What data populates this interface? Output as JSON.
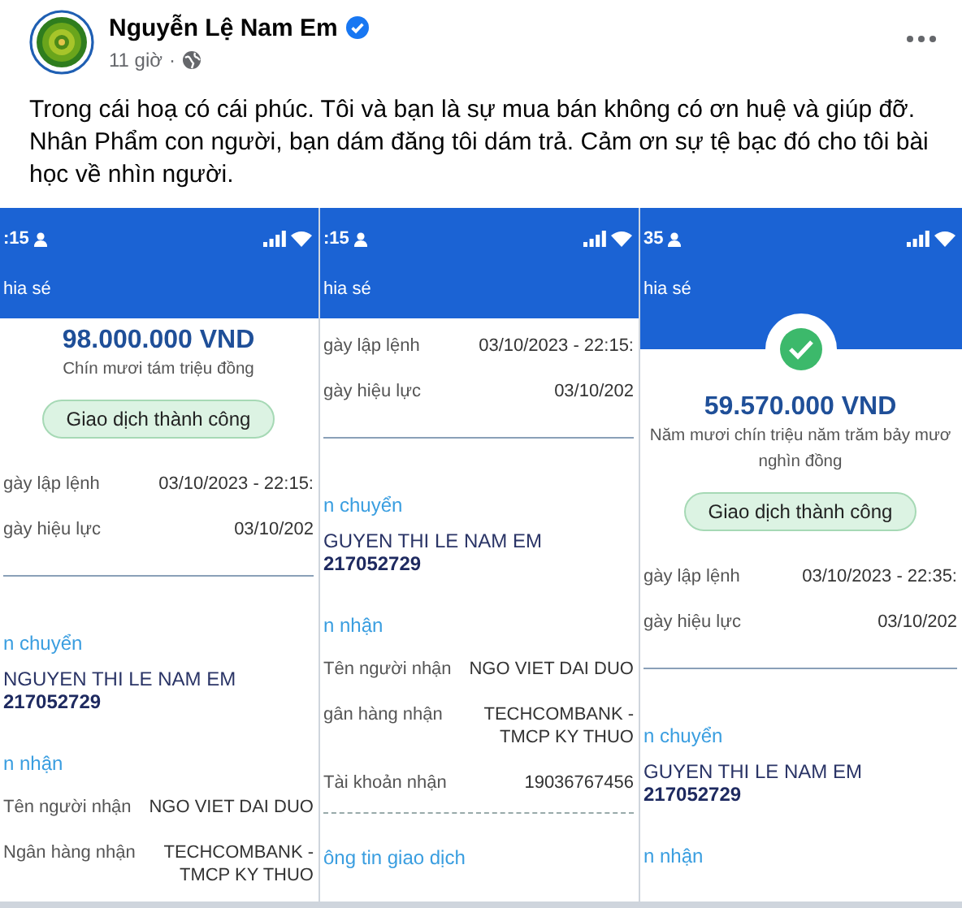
{
  "author": {
    "name": "Nguyễn Lệ Nam Em",
    "verified": true
  },
  "time": "11 giờ",
  "separator": "·",
  "text": "Trong cái hoạ có cái phúc. Tôi và bạn là sự mua bán không có ơn huệ và giúp đỡ. Nhân Phẩm con người, bạn dám đăng tôi dám trả. Cảm ơn sự tệ bạc đó cho tôi bài học về nhìn người.",
  "screenshots": [
    {
      "status_time": ":15",
      "share_label": "hia sé",
      "success_icon": false,
      "items": [
        {
          "kind": "amount",
          "text": "98.000.000 VND"
        },
        {
          "kind": "words",
          "lines": [
            "Chín mươi tám triệu đồng"
          ]
        },
        {
          "kind": "status",
          "text": "Giao dịch thành công"
        },
        {
          "kind": "detail",
          "label": "gày lập lệnh",
          "value": "03/10/2023 - 22:15:"
        },
        {
          "kind": "detail",
          "label": "gày hiệu lực",
          "value": "03/10/202"
        },
        {
          "kind": "rule"
        },
        {
          "kind": "section",
          "text": "n chuyển"
        },
        {
          "kind": "account",
          "name": "NGUYEN THI LE NAM EM",
          "number": "217052729"
        },
        {
          "kind": "section",
          "text": "n nhận"
        },
        {
          "kind": "detail",
          "label": "Tên người nhận",
          "value": "NGO VIET DAI DUO"
        },
        {
          "kind": "detail",
          "label": "Ngân hàng nhận",
          "value": "TECHCOMBANK -",
          "value2": "TMCP KY THUO"
        }
      ]
    },
    {
      "status_time": ":15",
      "share_label": "hia sé",
      "success_icon": false,
      "items": [
        {
          "kind": "detail",
          "label": "gày lập lệnh",
          "value": "03/10/2023 - 22:15:"
        },
        {
          "kind": "detail",
          "label": "gày hiệu lực",
          "value": "03/10/202"
        },
        {
          "kind": "rule"
        },
        {
          "kind": "section",
          "text": "n chuyển"
        },
        {
          "kind": "account",
          "name": "GUYEN THI LE NAM EM",
          "number": "217052729"
        },
        {
          "kind": "section",
          "text": "n nhận"
        },
        {
          "kind": "detail",
          "label": "Tên người nhận",
          "value": "NGO VIET DAI DUO"
        },
        {
          "kind": "detail",
          "label": "gân hàng nhận",
          "value": "TECHCOMBANK -",
          "value2": "TMCP KY THUO"
        },
        {
          "kind": "detail",
          "label": "Tài khoản nhận",
          "value": "19036767456"
        },
        {
          "kind": "dashed"
        },
        {
          "kind": "section",
          "text": "ông tin giao dịch"
        }
      ]
    },
    {
      "status_time": "35",
      "share_label": "hia sé",
      "success_icon": true,
      "items": [
        {
          "kind": "amount",
          "text": "59.570.000 VND"
        },
        {
          "kind": "words",
          "lines": [
            "Năm mươi chín triệu năm trăm bảy mươ",
            "nghìn đồng"
          ]
        },
        {
          "kind": "status",
          "text": "Giao dịch thành công"
        },
        {
          "kind": "detail",
          "label": "gày lập lệnh",
          "value": "03/10/2023 - 22:35:"
        },
        {
          "kind": "detail",
          "label": "gày hiệu lực",
          "value": "03/10/202"
        },
        {
          "kind": "rule"
        },
        {
          "kind": "section",
          "text": "n chuyển"
        },
        {
          "kind": "account",
          "name": "GUYEN THI LE NAM EM",
          "number": "217052729"
        },
        {
          "kind": "section",
          "text": "n nhận"
        }
      ]
    }
  ]
}
